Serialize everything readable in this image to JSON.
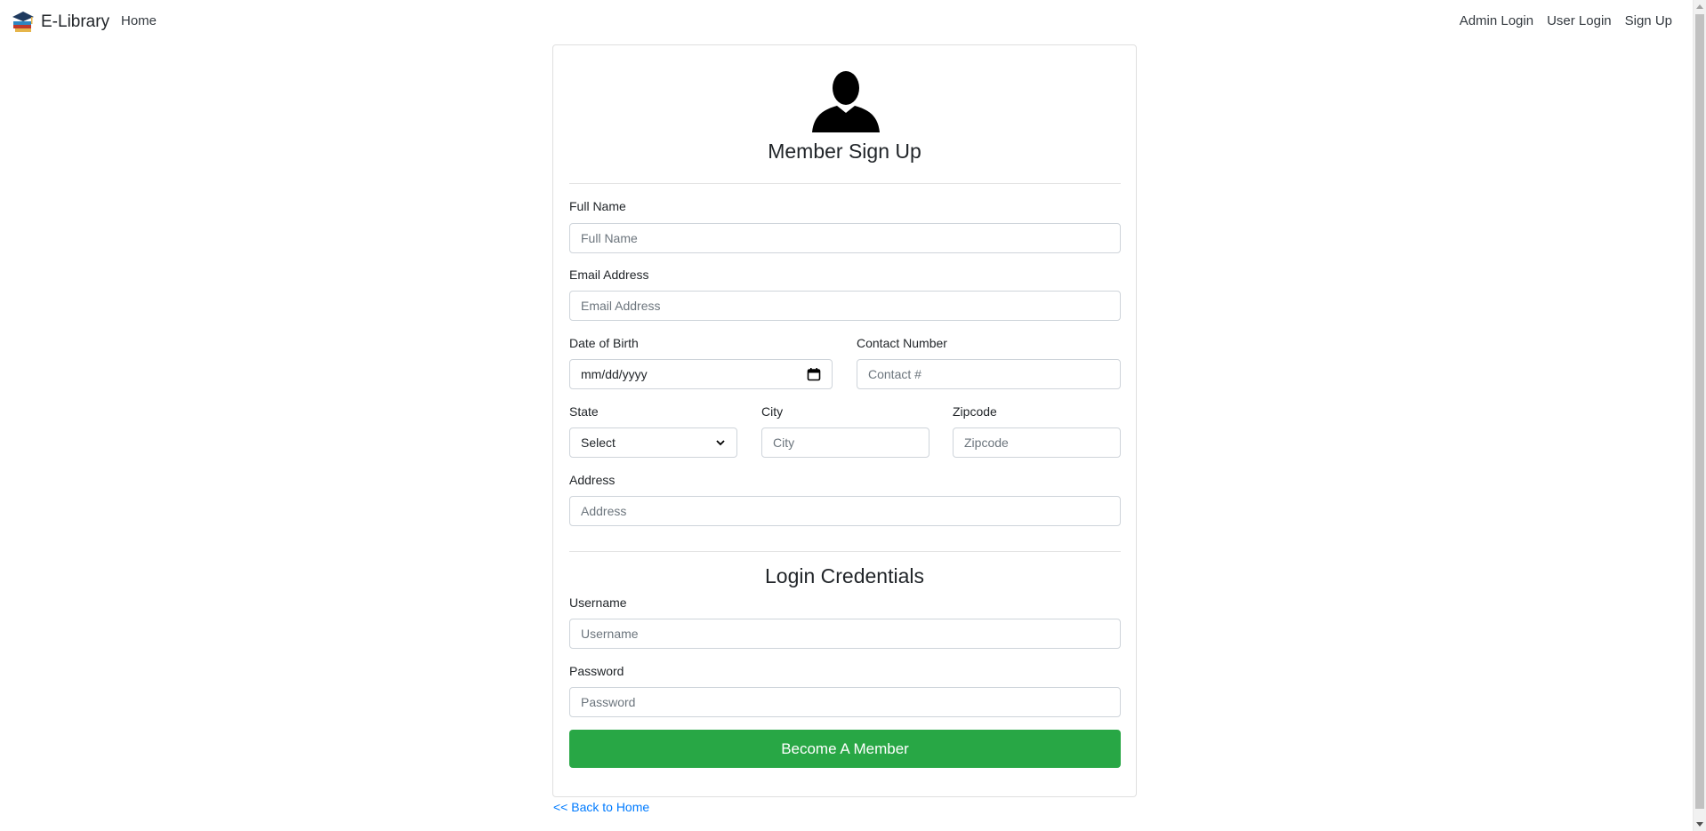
{
  "navbar": {
    "brand": "E-Library",
    "home": "Home",
    "admin_login": "Admin Login",
    "user_login": "User Login",
    "sign_up": "Sign Up"
  },
  "form": {
    "title": "Member Sign Up",
    "full_name": {
      "label": "Full Name",
      "placeholder": "Full Name"
    },
    "email": {
      "label": "Email Address",
      "placeholder": "Email Address"
    },
    "dob": {
      "label": "Date of Birth",
      "placeholder": "mm/dd/yyyy"
    },
    "contact": {
      "label": "Contact Number",
      "placeholder": "Contact #"
    },
    "state": {
      "label": "State",
      "selected": "Select"
    },
    "city": {
      "label": "City",
      "placeholder": "City"
    },
    "zipcode": {
      "label": "Zipcode",
      "placeholder": "Zipcode"
    },
    "address": {
      "label": "Address",
      "placeholder": "Address"
    },
    "credentials_title": "Login Credentials",
    "username": {
      "label": "Username",
      "placeholder": "Username"
    },
    "password": {
      "label": "Password",
      "placeholder": "Password"
    },
    "submit": "Become A Member"
  },
  "back_link": "<< Back to Home",
  "colors": {
    "submit_bg": "#28a745",
    "link": "#007bff"
  }
}
